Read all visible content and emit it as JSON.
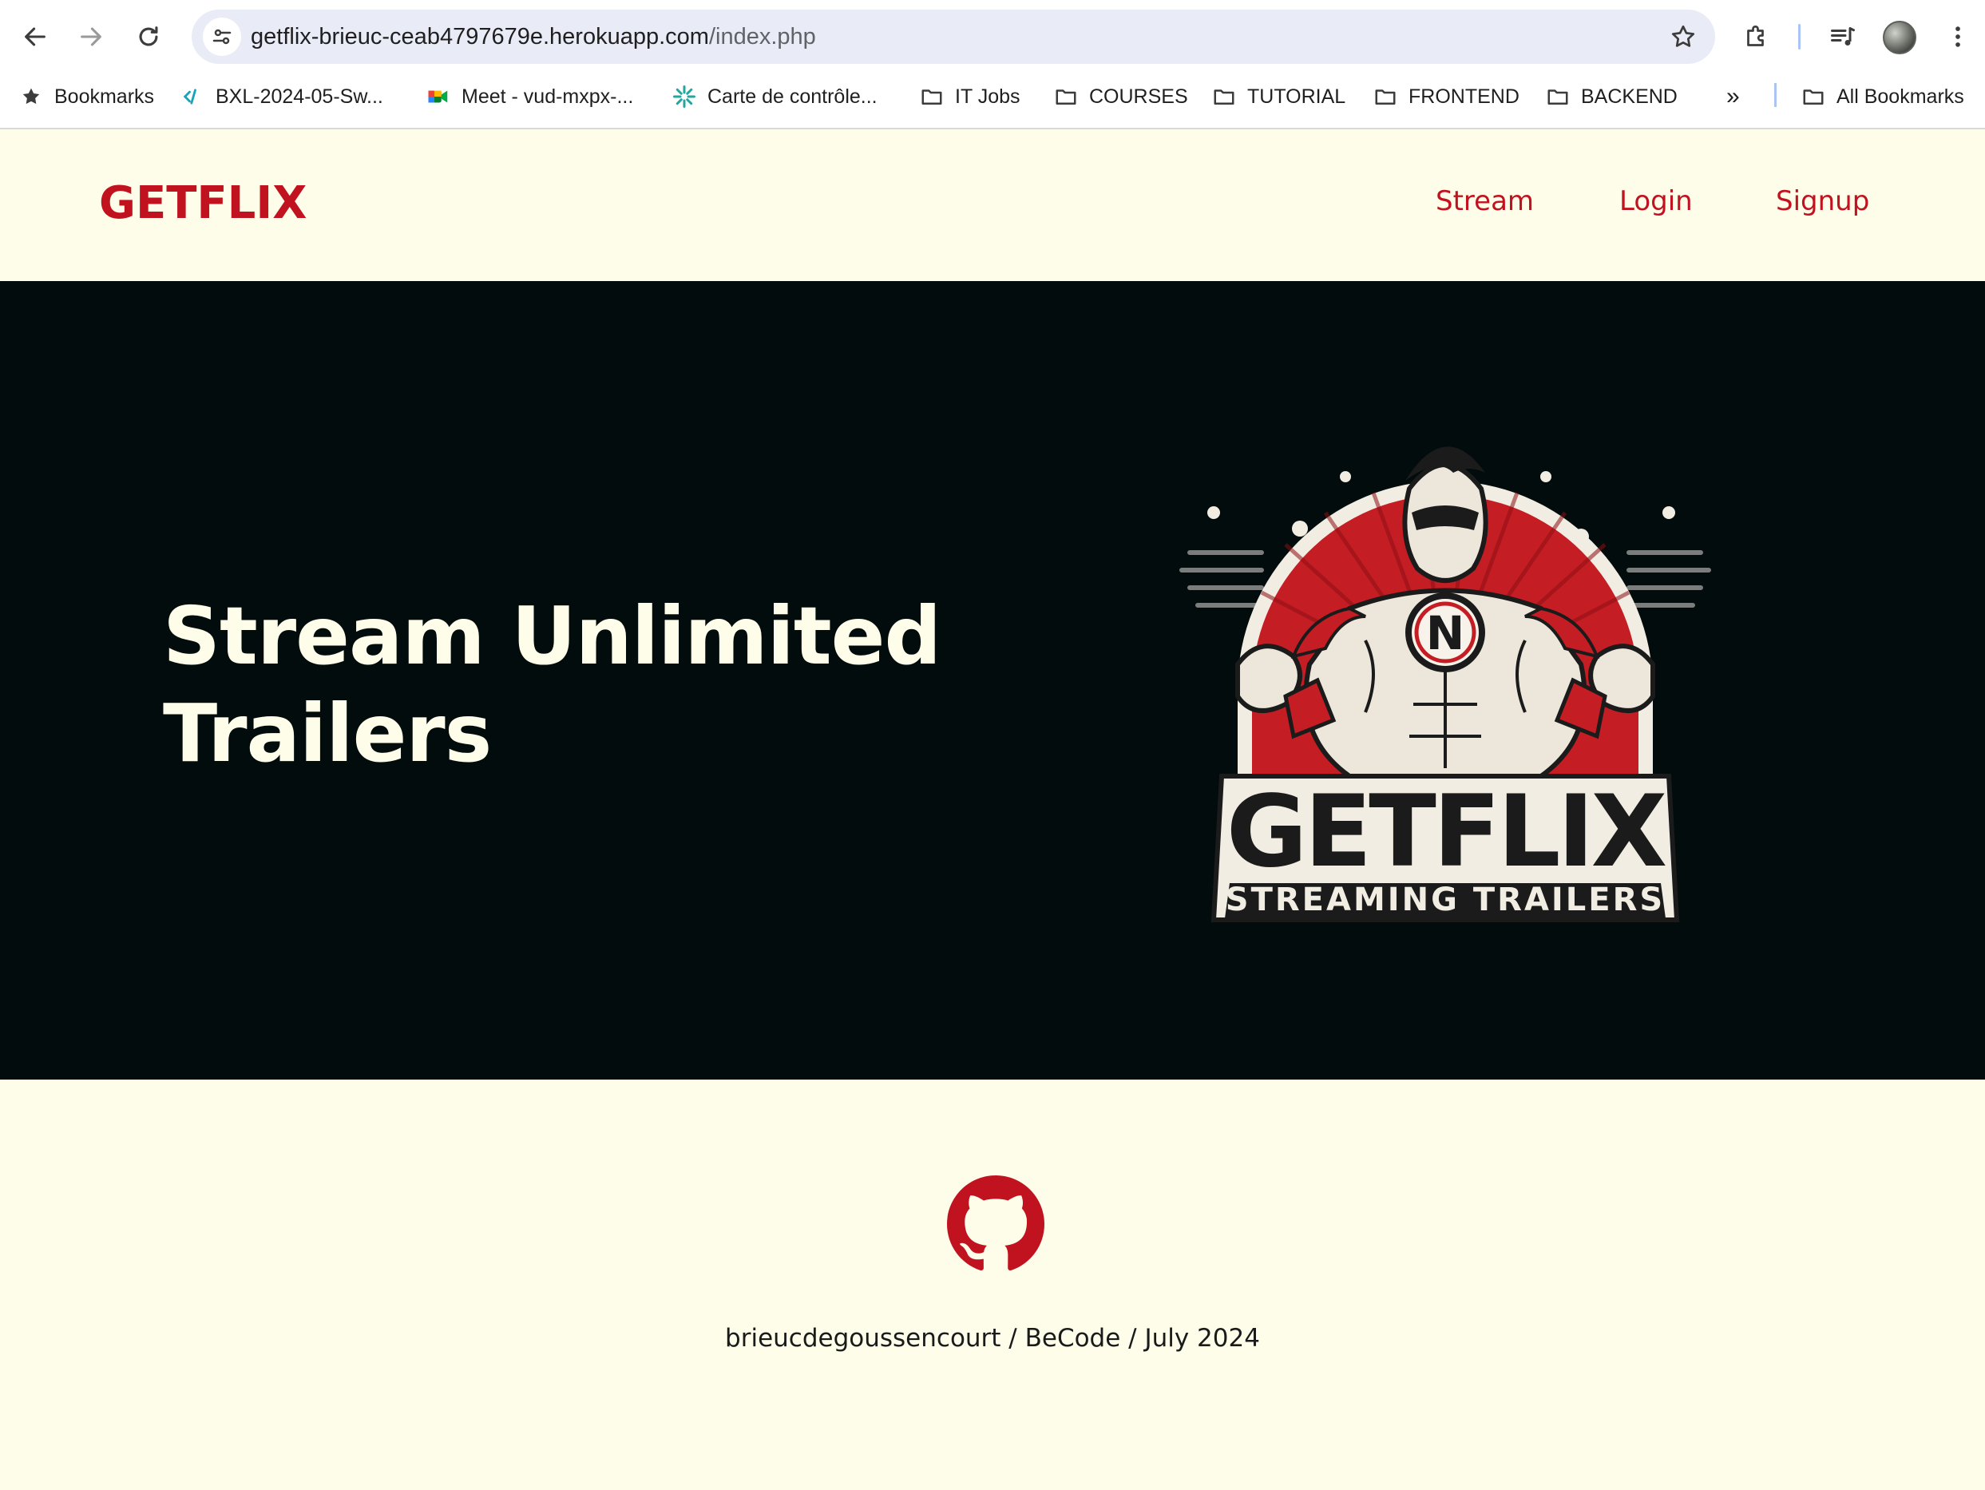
{
  "browser": {
    "url_host": "getflix-brieuc-ceab4797679e.herokuapp.com",
    "url_path": "/index.php",
    "icons": {
      "back": "back-arrow-icon",
      "forward": "forward-arrow-icon",
      "reload": "reload-icon",
      "site_info": "tune-icon",
      "bookmark_star": "star-icon",
      "extensions": "puzzle-icon",
      "media": "media-control-icon",
      "menu": "kebab-menu-icon"
    },
    "bookmarks": [
      {
        "label": "Bookmarks",
        "icon": "star-icon"
      },
      {
        "label": "BXL-2024-05-Sw...",
        "icon": "code-icon"
      },
      {
        "label": "Meet - vud-mxpx-...",
        "icon": "meet-icon"
      },
      {
        "label": "Carte de contrôle...",
        "icon": "spark-icon"
      },
      {
        "label": "IT Jobs",
        "icon": "folder-icon"
      },
      {
        "label": "COURSES",
        "icon": "folder-icon"
      },
      {
        "label": "TUTORIAL",
        "icon": "folder-icon"
      },
      {
        "label": "FRONTEND",
        "icon": "folder-icon"
      },
      {
        "label": "BACKEND",
        "icon": "folder-icon"
      }
    ],
    "overflow": "»",
    "all_bookmarks": "All Bookmarks"
  },
  "site": {
    "brand": "GETFLIX",
    "nav": [
      "Stream",
      "Login",
      "Signup"
    ],
    "hero_title_line1": "Stream Unlimited",
    "hero_title_line2": "Trailers",
    "logo": {
      "badge_letter": "N",
      "wordmark": "GETFLIX",
      "tagline": "STREAMING TRAILERS"
    },
    "footer_credit": "brieucdegoussencourt / BeCode / July 2024"
  },
  "colors": {
    "brand_red": "#c1121f",
    "cream": "#fdfde9",
    "hero_bg": "#030c0c"
  }
}
